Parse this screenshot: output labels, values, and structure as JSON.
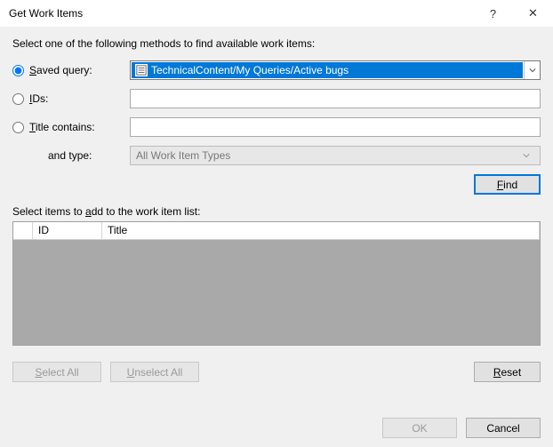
{
  "titlebar": {
    "title": "Get Work Items",
    "help": "?",
    "close": "✕"
  },
  "instruction": "Select one of the following methods to find available work items:",
  "options": {
    "savedQuery": {
      "label_pre": "S",
      "label_post": "aved query:"
    },
    "ids": {
      "label_pre": "I",
      "label_post": "Ds:"
    },
    "titleContains": {
      "label_pre": "T",
      "label_post": "itle contains:"
    },
    "andType": "and type:"
  },
  "savedQueryValue": "TechnicalContent/My Queries/Active bugs",
  "idsValue": "",
  "titleContainsValue": "",
  "typeValue": "All Work Item Types",
  "buttons": {
    "find_pre": "F",
    "find_post": "ind",
    "selectAll_pre": "S",
    "selectAll_post": "elect All",
    "unselectAll_pre": "U",
    "unselectAll_post": "nselect All",
    "reset_pre": "R",
    "reset_post": "eset",
    "ok": "OK",
    "cancel": "Cancel"
  },
  "listLabel": {
    "pre": "Select items to ",
    "u": "a",
    "post": "dd to the work item list:"
  },
  "grid": {
    "columns": {
      "id": "ID",
      "title": "Title"
    },
    "rows": []
  }
}
